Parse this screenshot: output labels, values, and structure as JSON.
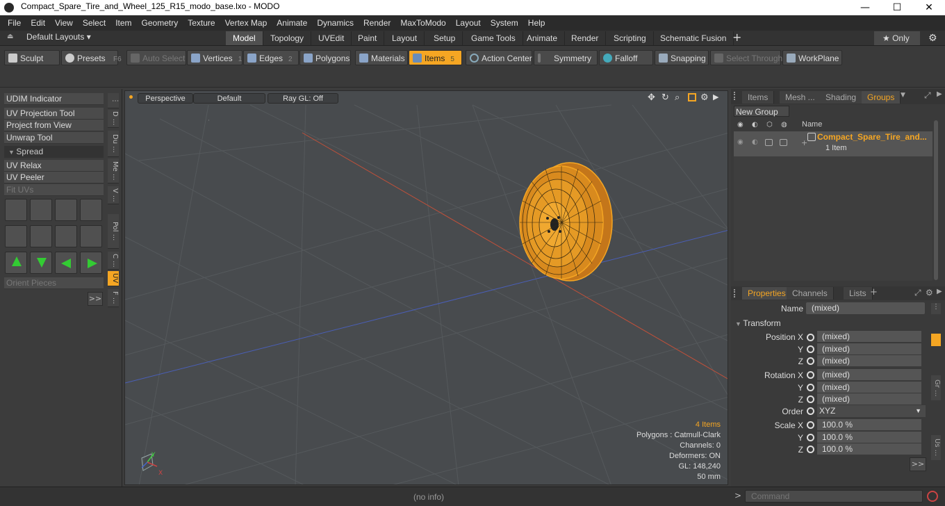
{
  "window": {
    "title": "Compact_Spare_Tire_and_Wheel_125_R15_modo_base.lxo - MODO",
    "minimize": "—",
    "maximize": "☐",
    "close": "✕"
  },
  "menu": [
    "File",
    "Edit",
    "View",
    "Select",
    "Item",
    "Geometry",
    "Texture",
    "Vertex Map",
    "Animate",
    "Dynamics",
    "Render",
    "MaxToModo",
    "Layout",
    "System",
    "Help"
  ],
  "layoutbar": {
    "layouts_label": "Default Layouts ▾",
    "tabs": [
      "Model",
      "Topology",
      "UVEdit",
      "Paint",
      "Layout",
      "Setup",
      "Game Tools",
      "Animate",
      "Render",
      "Scripting",
      "Schematic Fusion"
    ],
    "add": "+",
    "only_label": "★  Only",
    "gear": "⚙"
  },
  "toolbar": {
    "sculpt": "Sculpt",
    "presets": "Presets",
    "presets_key": "F6",
    "auto_select": "Auto Select",
    "vertices": "Vertices",
    "vertices_num": "1",
    "edges": "Edges",
    "edges_num": "2",
    "polygons": "Polygons",
    "materials": "Materials",
    "items": "Items",
    "items_num": "5",
    "action_center": "Action Center",
    "symmetry": "Symmetry",
    "falloff": "Falloff",
    "snapping": "Snapping",
    "select_through": "Select Through",
    "workplane": "WorkPlane"
  },
  "leftpanel": {
    "udim": "UDIM Indicator",
    "uv_projection": "UV Projection Tool",
    "project_from_view": "Project from View",
    "unwrap": "Unwrap Tool",
    "spread": "Spread",
    "uv_relax": "UV Relax",
    "uv_peeler": "UV Peeler",
    "fit_uvs": "Fit UVs",
    "orient_pieces": "Orient Pieces",
    "more": ">>",
    "vtabs": [
      "D ...",
      "Du ...",
      "Me ...",
      "V ...",
      "Pol ...",
      "C ...",
      "UV",
      "F ..."
    ]
  },
  "viewport": {
    "perspective": "Perspective",
    "default": "Default",
    "raygl": "Ray GL: Off",
    "info": {
      "items": "4 Items",
      "polygons": "Polygons : Catmull-Clark",
      "channels": "Channels: 0",
      "deformers": "Deformers: ON",
      "gl": "GL: 148,240",
      "size": "50 mm"
    },
    "axis_y": "Y",
    "axis_x": "X"
  },
  "rightpanel": {
    "tabs": [
      "Items",
      "Mesh ...",
      "Shading",
      "Groups"
    ],
    "new_group": "New Group",
    "col_name": "Name",
    "group_name": "Compact_Spare_Tire_and...",
    "group_count": "1 Item",
    "prop_tabs": [
      "Properties",
      "Channels",
      "Lists"
    ],
    "name_label": "Name",
    "name_value": "(mixed)",
    "transform": "Transform",
    "position_x": "Position X",
    "y": "Y",
    "z": "Z",
    "rotation_x": "Rotation X",
    "order": "Order",
    "order_value": "XYZ",
    "scale_x": "Scale X",
    "mixed": "(mixed)",
    "scale_val": "100.0 %",
    "more": ">>",
    "vtabs": [
      "Gr ...",
      "Us ..."
    ]
  },
  "status": {
    "info": "(no info)",
    "command_placeholder": "Command",
    "prompt": ">"
  },
  "colors": {
    "accent": "#f5a623",
    "wire": "#f5a623",
    "x_axis": "#c0503a",
    "z_axis": "#4a5fb8"
  }
}
